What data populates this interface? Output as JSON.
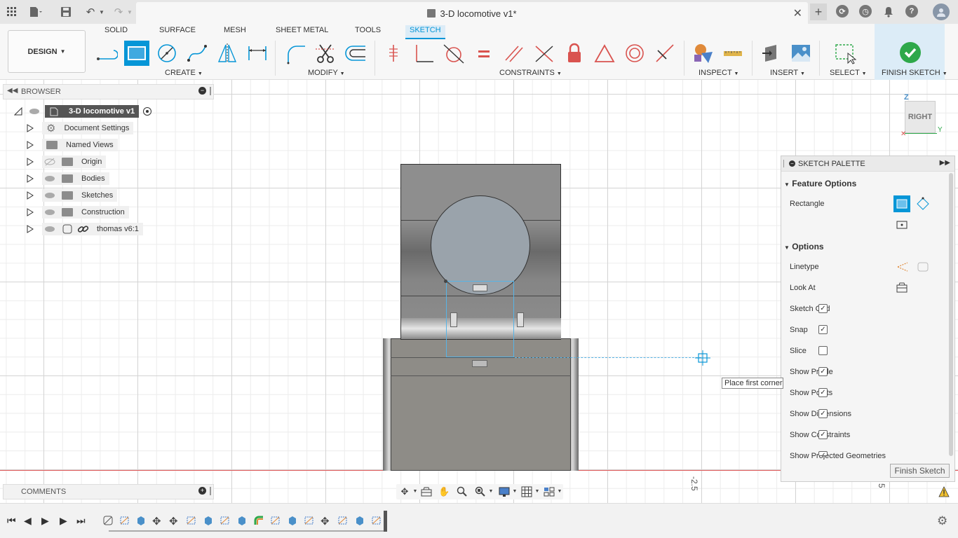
{
  "document_title": "3-D locomotive v1*",
  "workspace_button": "DESIGN",
  "workspace_tabs": [
    "SOLID",
    "SURFACE",
    "MESH",
    "SHEET METAL",
    "TOOLS",
    "SKETCH"
  ],
  "active_tab": "SKETCH",
  "toolbar_groups": {
    "create": "CREATE",
    "modify": "MODIFY",
    "constraints": "CONSTRAINTS",
    "inspect": "INSPECT",
    "insert": "INSERT",
    "select": "SELECT",
    "finish_sketch": "FINISH SKETCH"
  },
  "browser": {
    "title": "BROWSER",
    "root": "3-D locomotive v1",
    "items": [
      "Document Settings",
      "Named Views",
      "Origin",
      "Bodies",
      "Sketches",
      "Construction",
      "thomas v6:1"
    ]
  },
  "comments": {
    "title": "COMMENTS"
  },
  "view_cube": {
    "face": "RIGHT",
    "axis_z": "Z",
    "axis_y": "Y"
  },
  "sketch_palette": {
    "title": "SKETCH PALETTE",
    "feature_options_label": "Feature Options",
    "rectangle_label": "Rectangle",
    "options_label": "Options",
    "rows": [
      {
        "label": "Linetype"
      },
      {
        "label": "Look At"
      },
      {
        "label": "Sketch Grid",
        "checked": true
      },
      {
        "label": "Snap",
        "checked": true
      },
      {
        "label": "Slice",
        "checked": false
      },
      {
        "label": "Show Profile",
        "checked": true
      },
      {
        "label": "Show Points",
        "checked": true
      },
      {
        "label": "Show Dimensions",
        "checked": true
      },
      {
        "label": "Show Constraints",
        "checked": true
      },
      {
        "label": "Show Projected Geometries",
        "checked": true
      }
    ],
    "finish_button": "Finish Sketch"
  },
  "tooltip": "Place first corner",
  "axis_labels": [
    "-2.5",
    "5"
  ],
  "colors": {
    "accent": "#0696d7",
    "finish_green": "#2ea84a",
    "constraint_red": "#d9534f",
    "model_gray": "#8e8e8e"
  }
}
